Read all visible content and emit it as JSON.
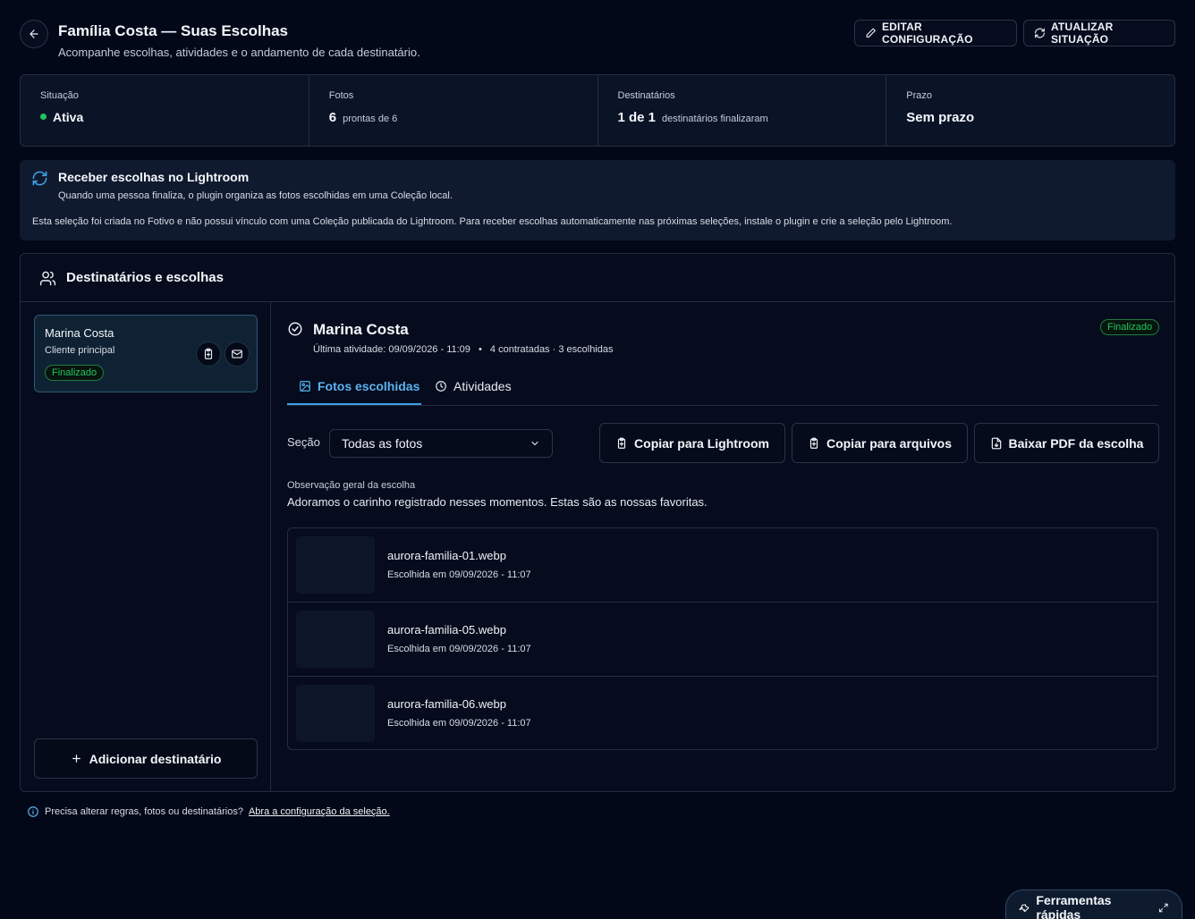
{
  "header": {
    "title": "Família Costa — Suas Escolhas",
    "subtitle": "Acompanhe escolhas, atividades e o andamento de cada destinatário.",
    "edit_button": "EDITAR CONFIGURAÇÃO",
    "refresh_button": "ATUALIZAR SITUAÇÃO"
  },
  "stats": {
    "status": {
      "label": "Situação",
      "value": "Ativa",
      "color": "#22c55e"
    },
    "photos": {
      "label": "Fotos",
      "value": "6",
      "suffix": "prontas de 6"
    },
    "recipients": {
      "label": "Destinatários",
      "value": "1 de 1",
      "suffix": "destinatários finalizaram"
    },
    "deadline": {
      "label": "Prazo",
      "value": "Sem prazo"
    }
  },
  "lightroom_notice": {
    "title": "Receber escolhas no Lightroom",
    "subtitle": "Quando uma pessoa finaliza, o plugin organiza as fotos escolhidas em uma Coleção local.",
    "body": "Esta seleção foi criada no Fotivo e não possui vínculo com uma Coleção publicada do Lightroom. Para receber escolhas automaticamente nas próximas seleções, instale o plugin e crie a seleção pelo Lightroom."
  },
  "recipients_panel": {
    "title": "Destinatários e escolhas",
    "add_button": "Adicionar destinatário",
    "items": [
      {
        "name": "Marina Costa",
        "role": "Cliente principal",
        "status": "Finalizado"
      }
    ]
  },
  "detail": {
    "name": "Marina Costa",
    "status": "Finalizado",
    "last_activity": "Última atividade: 09/09/2026 - 11:09",
    "counts": "4 contratadas · 3 escolhidas",
    "tabs": [
      "Fotos escolhidas",
      "Atividades"
    ],
    "section_label": "Seção",
    "section_value": "Todas as fotos",
    "copy_lightroom": "Copiar para Lightroom",
    "copy_files": "Copiar para arquivos",
    "download_pdf": "Baixar PDF da escolha",
    "observation_label": "Observação geral da escolha",
    "observation_text": "Adoramos o carinho registrado nesses momentos. Estas são as nossas favoritas.",
    "photos": [
      {
        "name": "aurora-familia-01.webp",
        "chosen": "Escolhida em 09/09/2026 - 11:07"
      },
      {
        "name": "aurora-familia-05.webp",
        "chosen": "Escolhida em 09/09/2026 - 11:07"
      },
      {
        "name": "aurora-familia-06.webp",
        "chosen": "Escolhida em 09/09/2026 - 11:07"
      }
    ]
  },
  "footer": {
    "note": "Precisa alterar regras, fotos ou destinatários?",
    "link": "Abra a configuração da seleção."
  },
  "quick_tools": {
    "label": "Ferramentas rápidas"
  },
  "colors": {
    "accent": "#3ea1e6",
    "success": "#22c55e",
    "background": "#030818"
  }
}
